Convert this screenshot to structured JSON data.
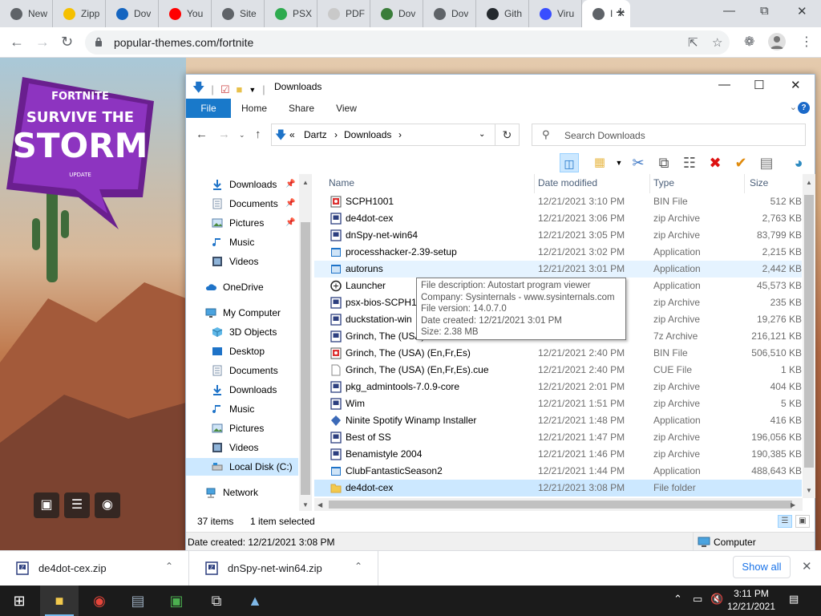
{
  "browser": {
    "tabs": [
      {
        "label": "New",
        "fav_color": "#5f6368"
      },
      {
        "label": "Zipp",
        "fav_color": "#f5c000"
      },
      {
        "label": "Dov",
        "fav_color": "#1565c0"
      },
      {
        "label": "You",
        "fav_color": "#ff0000"
      },
      {
        "label": "Site",
        "fav_color": "#5f6368"
      },
      {
        "label": "PSX",
        "fav_color": "#2eab4f"
      },
      {
        "label": "PDF",
        "fav_color": "#c9c9c9"
      },
      {
        "label": "Dov",
        "fav_color": "#3a7d3a"
      },
      {
        "label": "Dov",
        "fav_color": "#5f6368"
      },
      {
        "label": "Gith",
        "fav_color": "#24292e"
      },
      {
        "label": "Viru",
        "fav_color": "#394eff"
      },
      {
        "label": "I",
        "fav_color": "#5f6368"
      }
    ],
    "new_tab": "+",
    "url": "popular-themes.com/fortnite"
  },
  "page": {
    "logo_line1": "FORTNITE",
    "logo_line2": "SURVIVE THE",
    "logo_line3": "STORM",
    "logo_line4": "UPDATE"
  },
  "explorer": {
    "title": "Downloads",
    "ribbon_tabs": [
      "File",
      "Home",
      "Share",
      "View"
    ],
    "breadcrumb": [
      "«",
      "Dartz",
      "›",
      "Downloads",
      "›"
    ],
    "search_placeholder": "Search Downloads",
    "nav_items": [
      {
        "label": "Downloads",
        "icon": "download-arrow-icon",
        "pinned": true
      },
      {
        "label": "Documents",
        "icon": "document-icon",
        "pinned": true
      },
      {
        "label": "Pictures",
        "icon": "pictures-icon",
        "pinned": true
      },
      {
        "label": "Music",
        "icon": "music-icon",
        "pinned": false
      },
      {
        "label": "Videos",
        "icon": "videos-icon",
        "pinned": false
      },
      {
        "label": "OneDrive",
        "icon": "cloud-icon",
        "pinned": false
      },
      {
        "label": "My Computer",
        "icon": "computer-icon",
        "pinned": false
      },
      {
        "label": "3D Objects",
        "icon": "cube-icon",
        "pinned": false
      },
      {
        "label": "Desktop",
        "icon": "desktop-icon",
        "pinned": false
      },
      {
        "label": "Documents",
        "icon": "document-icon",
        "pinned": false
      },
      {
        "label": "Downloads",
        "icon": "download-arrow-icon",
        "pinned": false
      },
      {
        "label": "Music",
        "icon": "music-icon",
        "pinned": false
      },
      {
        "label": "Pictures",
        "icon": "pictures-icon",
        "pinned": false
      },
      {
        "label": "Videos",
        "icon": "videos-icon",
        "pinned": false
      },
      {
        "label": "Local Disk (C:)",
        "icon": "drive-icon",
        "pinned": false
      },
      {
        "label": "Network",
        "icon": "network-icon",
        "pinned": false
      }
    ],
    "columns": [
      "Name",
      "Date modified",
      "Type",
      "Size"
    ],
    "files": [
      {
        "name": "SCPH1001",
        "date": "12/21/2021 3:10 PM",
        "type": "BIN File",
        "size": "512 KB",
        "icon": "bin-icon"
      },
      {
        "name": "de4dot-cex",
        "date": "12/21/2021 3:06 PM",
        "type": "zip Archive",
        "size": "2,763 KB",
        "icon": "zip-icon"
      },
      {
        "name": "dnSpy-net-win64",
        "date": "12/21/2021 3:05 PM",
        "type": "zip Archive",
        "size": "83,799 KB",
        "icon": "zip-icon"
      },
      {
        "name": "processhacker-2.39-setup",
        "date": "12/21/2021 3:02 PM",
        "type": "Application",
        "size": "2,215 KB",
        "icon": "app-icon"
      },
      {
        "name": "autoruns",
        "date": "12/21/2021 3:01 PM",
        "type": "Application",
        "size": "2,442 KB",
        "icon": "app-icon"
      },
      {
        "name": "Launcher",
        "date": "",
        "type": "Application",
        "size": "45,573 KB",
        "icon": "launcher-icon"
      },
      {
        "name": "psx-bios-SCPH10",
        "date": "",
        "type": "zip Archive",
        "size": "235 KB",
        "icon": "zip-icon"
      },
      {
        "name": "duckstation-win",
        "date": "",
        "type": "zip Archive",
        "size": "19,276 KB",
        "icon": "zip-icon"
      },
      {
        "name": "Grinch, The (USA)",
        "date": "",
        "type": "7z Archive",
        "size": "216,121 KB",
        "icon": "zip-icon"
      },
      {
        "name": "Grinch, The (USA) (En,Fr,Es)",
        "date": "12/21/2021 2:40 PM",
        "type": "BIN File",
        "size": "506,510 KB",
        "icon": "bin-icon"
      },
      {
        "name": "Grinch, The (USA) (En,Fr,Es).cue",
        "date": "12/21/2021 2:40 PM",
        "type": "CUE File",
        "size": "1 KB",
        "icon": "file-icon"
      },
      {
        "name": "pkg_admintools-7.0.9-core",
        "date": "12/21/2021 2:01 PM",
        "type": "zip Archive",
        "size": "404 KB",
        "icon": "zip-icon"
      },
      {
        "name": "Wim",
        "date": "12/21/2021 1:51 PM",
        "type": "zip Archive",
        "size": "5 KB",
        "icon": "zip-icon"
      },
      {
        "name": "Ninite Spotify Winamp Installer",
        "date": "12/21/2021 1:48 PM",
        "type": "Application",
        "size": "416 KB",
        "icon": "ninite-icon"
      },
      {
        "name": "Best of SS",
        "date": "12/21/2021 1:47 PM",
        "type": "zip Archive",
        "size": "196,056 KB",
        "icon": "zip-icon"
      },
      {
        "name": "Benamistyle 2004",
        "date": "12/21/2021 1:46 PM",
        "type": "zip Archive",
        "size": "190,385 KB",
        "icon": "zip-icon"
      },
      {
        "name": "ClubFantasticSeason2",
        "date": "12/21/2021 1:44 PM",
        "type": "Application",
        "size": "488,643 KB",
        "icon": "app-icon"
      },
      {
        "name": "de4dot-cex",
        "date": "12/21/2021 3:08 PM",
        "type": "File folder",
        "size": "",
        "icon": "folder-icon"
      }
    ],
    "tooltip": [
      "File description: Autostart program viewer",
      "Company: Sysinternals - www.sysinternals.com",
      "File version: 14.0.7.0",
      "Date created: 12/21/2021 3:01 PM",
      "Size: 2.38 MB"
    ],
    "status_count": "37 items",
    "status_selected": "1 item selected",
    "detail_left": "Date created: 12/21/2021 3:08 PM",
    "detail_right": "Computer"
  },
  "downloads_shelf": {
    "items": [
      "de4dot-cex.zip",
      "dnSpy-net-win64.zip"
    ],
    "show_all": "Show all"
  },
  "taskbar": {
    "time": "3:11 PM",
    "date": "12/21/2021"
  }
}
